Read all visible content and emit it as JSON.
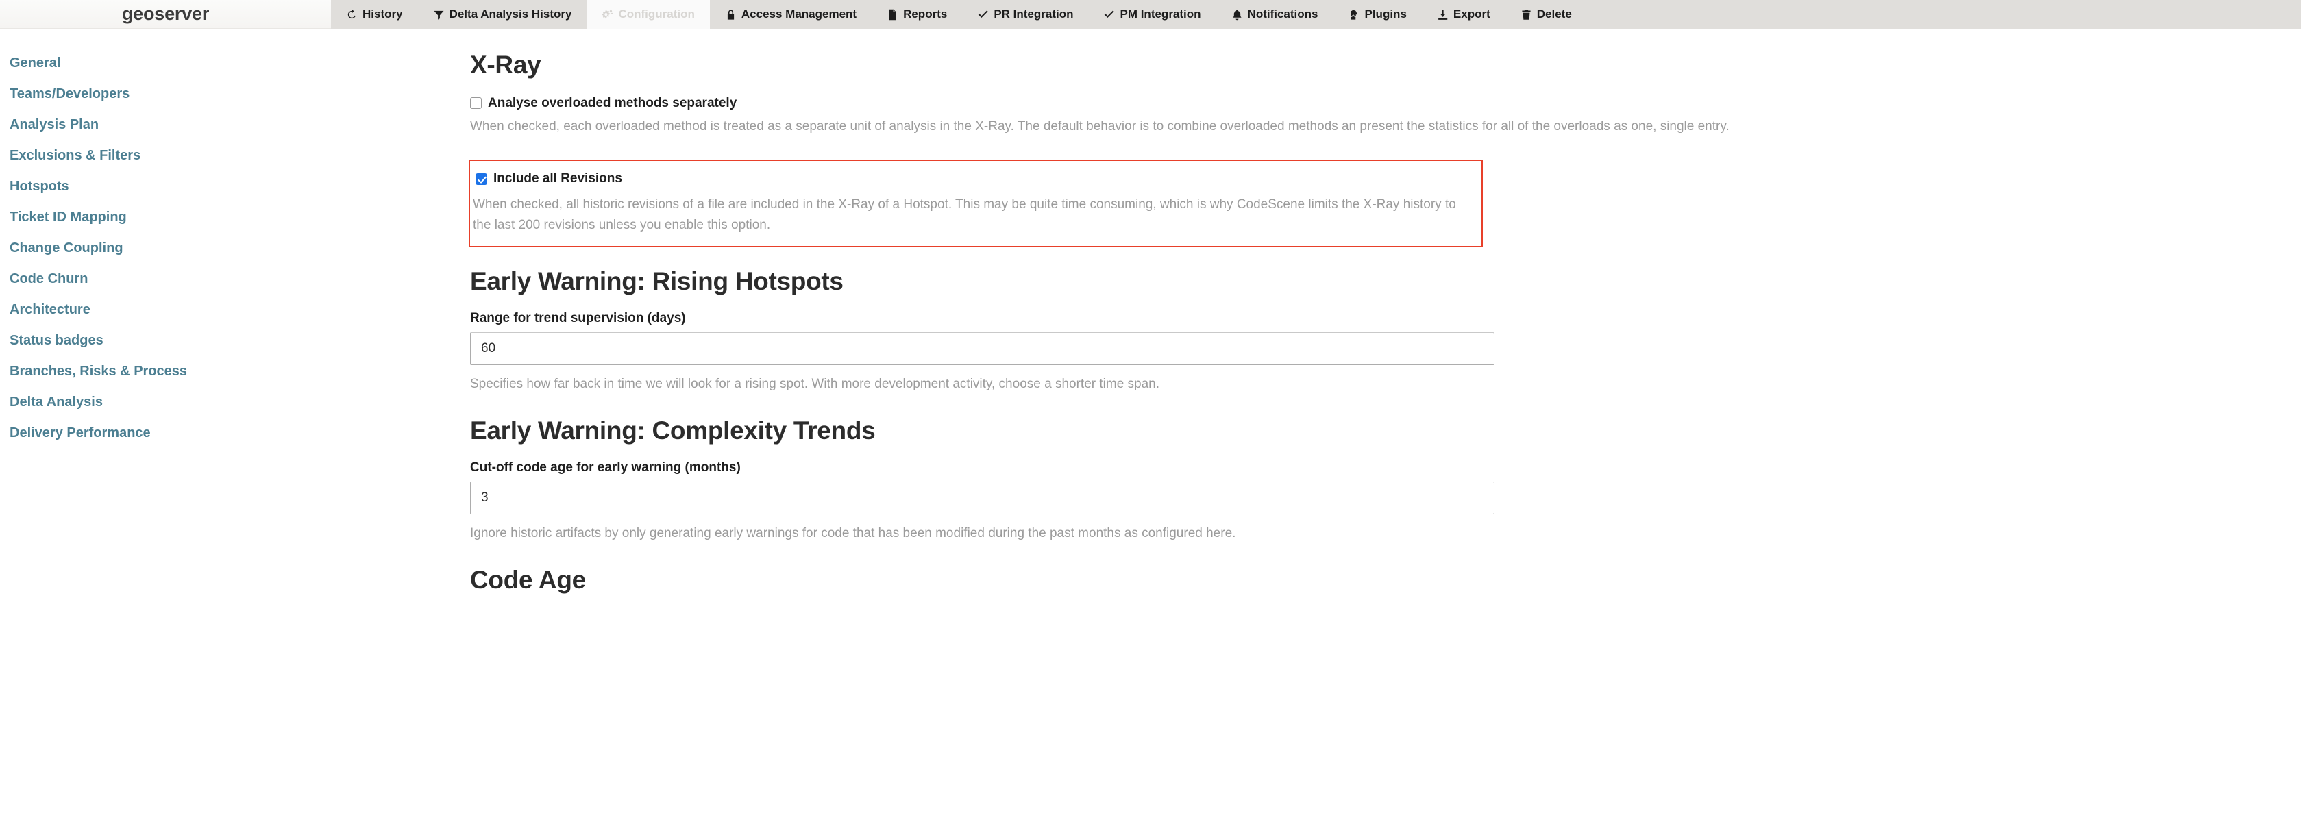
{
  "header": {
    "brand": "geoserver",
    "nav_items": [
      {
        "label": "History",
        "icon": "history-icon",
        "active": false
      },
      {
        "label": "Delta Analysis History",
        "icon": "funnel-icon",
        "active": false
      },
      {
        "label": "Configuration",
        "icon": "gears-icon",
        "active": true
      },
      {
        "label": "Access Management",
        "icon": "lock-icon",
        "active": false
      },
      {
        "label": "Reports",
        "icon": "document-icon",
        "active": false
      },
      {
        "label": "PR Integration",
        "icon": "check-icon",
        "active": false
      },
      {
        "label": "PM Integration",
        "icon": "check-icon",
        "active": false
      },
      {
        "label": "Notifications",
        "icon": "bell-icon",
        "active": false
      },
      {
        "label": "Plugins",
        "icon": "puzzle-icon",
        "active": false
      },
      {
        "label": "Export",
        "icon": "download-icon",
        "active": false
      },
      {
        "label": "Delete",
        "icon": "trash-icon",
        "active": false
      }
    ]
  },
  "sidebar": {
    "items": [
      {
        "label": "General"
      },
      {
        "label": "Teams/Developers"
      },
      {
        "label": "Analysis Plan"
      },
      {
        "label": "Exclusions & Filters"
      },
      {
        "label": "Hotspots"
      },
      {
        "label": "Ticket ID Mapping"
      },
      {
        "label": "Change Coupling"
      },
      {
        "label": "Code Churn"
      },
      {
        "label": "Architecture"
      },
      {
        "label": "Status badges"
      },
      {
        "label": "Branches, Risks & Process"
      },
      {
        "label": "Delta Analysis"
      },
      {
        "label": "Delivery Performance"
      }
    ]
  },
  "main": {
    "xray": {
      "title": "X-Ray",
      "overloaded": {
        "label": "Analyse overloaded methods separately",
        "checked": false,
        "helper": "When checked, each overloaded method is treated as a separate unit of analysis in the X-Ray. The default behavior is to combine overloaded methods an present the statistics for all of the overloads as one, single entry."
      },
      "revisions": {
        "label": "Include all Revisions",
        "checked": true,
        "helper": "When checked, all historic revisions of a file are included in the X-Ray of a Hotspot. This may be quite time consuming, which is why CodeScene limits the X-Ray history to the last 200 revisions unless you enable this option.",
        "highlight_color": "#e8402a"
      }
    },
    "rising_hotspots": {
      "title": "Early Warning: Rising Hotspots",
      "field_label": "Range for trend supervision (days)",
      "field_value": "60",
      "helper": "Specifies how far back in time we will look for a rising spot. With more development activity, choose a shorter time span."
    },
    "complexity_trends": {
      "title": "Early Warning: Complexity Trends",
      "field_label": "Cut-off code age for early warning (months)",
      "field_value": "3",
      "helper": "Ignore historic artifacts by only generating early warnings for code that has been modified during the past months as configured here."
    },
    "code_age": {
      "title": "Code Age"
    }
  },
  "colors": {
    "accent_link": "#4c7f92",
    "highlight": "#e8402a",
    "checkbox_checked": "#1b72e8",
    "topbar_bg": "#e0dedb"
  }
}
